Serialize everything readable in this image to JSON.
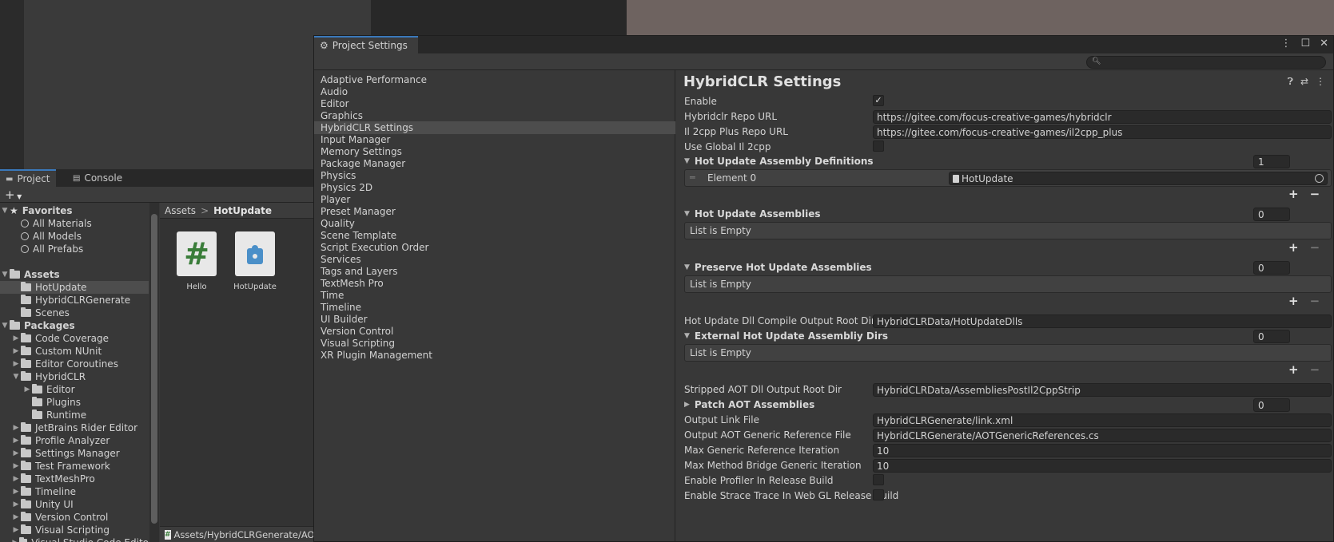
{
  "project_panel": {
    "tabs": [
      "Project",
      "Console"
    ],
    "add_label": "+",
    "tree": [
      {
        "label": "Favorites",
        "kind": "section-star",
        "indent": 0,
        "arrow": "▼"
      },
      {
        "label": "All Materials",
        "kind": "search",
        "indent": 1
      },
      {
        "label": "All Models",
        "kind": "search",
        "indent": 1
      },
      {
        "label": "All Prefabs",
        "kind": "search",
        "indent": 1
      },
      {
        "label": "",
        "kind": "spacer",
        "indent": 0
      },
      {
        "label": "Assets",
        "kind": "section-folder",
        "indent": 0,
        "arrow": "▼"
      },
      {
        "label": "HotUpdate",
        "kind": "folder",
        "indent": 1,
        "selected": true
      },
      {
        "label": "HybridCLRGenerate",
        "kind": "folder",
        "indent": 1
      },
      {
        "label": "Scenes",
        "kind": "folder",
        "indent": 1
      },
      {
        "label": "Packages",
        "kind": "section-folder",
        "indent": 0,
        "arrow": "▼"
      },
      {
        "label": "Code Coverage",
        "kind": "folder",
        "indent": 1,
        "arrow": "▶"
      },
      {
        "label": "Custom NUnit",
        "kind": "folder",
        "indent": 1,
        "arrow": "▶"
      },
      {
        "label": "Editor Coroutines",
        "kind": "folder",
        "indent": 1,
        "arrow": "▶"
      },
      {
        "label": "HybridCLR",
        "kind": "folder",
        "indent": 1,
        "arrow": "▼"
      },
      {
        "label": "Editor",
        "kind": "folder",
        "indent": 2,
        "arrow": "▶"
      },
      {
        "label": "Plugins",
        "kind": "folder",
        "indent": 2
      },
      {
        "label": "Runtime",
        "kind": "folder",
        "indent": 2
      },
      {
        "label": "JetBrains Rider Editor",
        "kind": "folder",
        "indent": 1,
        "arrow": "▶"
      },
      {
        "label": "Profile Analyzer",
        "kind": "folder",
        "indent": 1,
        "arrow": "▶"
      },
      {
        "label": "Settings Manager",
        "kind": "folder",
        "indent": 1,
        "arrow": "▶"
      },
      {
        "label": "Test Framework",
        "kind": "folder",
        "indent": 1,
        "arrow": "▶"
      },
      {
        "label": "TextMeshPro",
        "kind": "folder",
        "indent": 1,
        "arrow": "▶"
      },
      {
        "label": "Timeline",
        "kind": "folder",
        "indent": 1,
        "arrow": "▶"
      },
      {
        "label": "Unity UI",
        "kind": "folder",
        "indent": 1,
        "arrow": "▶"
      },
      {
        "label": "Version Control",
        "kind": "folder",
        "indent": 1,
        "arrow": "▶"
      },
      {
        "label": "Visual Scripting",
        "kind": "folder",
        "indent": 1,
        "arrow": "▶"
      },
      {
        "label": "Visual Studio Code Edito",
        "kind": "folder",
        "indent": 1,
        "arrow": "▶"
      }
    ],
    "breadcrumb": {
      "root": "Assets",
      "sep": ">",
      "current": "HotUpdate"
    },
    "assets": [
      {
        "label": "Hello",
        "icon": "csharp-script-icon",
        "glyph": "#"
      },
      {
        "label": "HotUpdate",
        "icon": "assembly-definition-icon",
        "glyph": ""
      }
    ],
    "status_path": "Assets/HybridCLRGenerate/AOTGenericReferences.cs"
  },
  "settings_window": {
    "title": "Project Settings",
    "categories": [
      "Adaptive Performance",
      "Audio",
      "Editor",
      "Graphics",
      "HybridCLR Settings",
      "Input Manager",
      "Memory Settings",
      "Package Manager",
      "Physics",
      "Physics 2D",
      "Player",
      "Preset Manager",
      "Quality",
      "Scene Template",
      "Script Execution Order",
      "Services",
      "Tags and Layers",
      "TextMesh Pro",
      "Time",
      "Timeline",
      "UI Builder",
      "Version Control",
      "Visual Scripting",
      "XR Plugin Management"
    ],
    "selected_category": "HybridCLR Settings",
    "page_title": "HybridCLR Settings",
    "fields": {
      "enable_label": "Enable",
      "enable_check": "✓",
      "repo_url_label": "Hybridclr Repo URL",
      "repo_url_value": "https://gitee.com/focus-creative-games/hybridclr",
      "il2cpp_url_label": "Il 2cpp Plus Repo URL",
      "il2cpp_url_value": "https://gitee.com/focus-creative-games/il2cpp_plus",
      "use_global_label": "Use Global Il 2cpp",
      "hot_defs_label": "Hot Update Assembly Definitions",
      "hot_defs_count": "1",
      "element0_label": "Element 0",
      "element0_value": "HotUpdate",
      "hot_asm_label": "Hot Update Assemblies",
      "hot_asm_count": "0",
      "empty_text": "List is Empty",
      "preserve_label": "Preserve Hot Update Assemblies",
      "preserve_count": "0",
      "dll_out_label": "Hot Update Dll Compile Output Root Dir",
      "dll_out_value": "HybridCLRData/HotUpdateDlls",
      "ext_dirs_label": "External Hot Update Assembliy Dirs",
      "ext_dirs_count": "0",
      "stripped_label": "Stripped AOT Dll Output Root Dir",
      "stripped_value": "HybridCLRData/AssembliesPostIl2CppStrip",
      "patch_label": "Patch AOT Assemblies",
      "patch_count": "0",
      "link_label": "Output Link File",
      "link_value": "HybridCLRGenerate/link.xml",
      "aot_ref_label": "Output AOT Generic Reference File",
      "aot_ref_value": "HybridCLRGenerate/AOTGenericReferences.cs",
      "max_gen_label": "Max Generic Reference Iteration",
      "max_gen_value": "10",
      "max_bridge_label": "Max Method Bridge Generic Iteration",
      "max_bridge_value": "10",
      "profiler_label": "Enable Profiler In Release Build",
      "strace_label": "Enable Strace Trace In Web GL Release Build"
    },
    "plus": "+",
    "minus": "−"
  }
}
